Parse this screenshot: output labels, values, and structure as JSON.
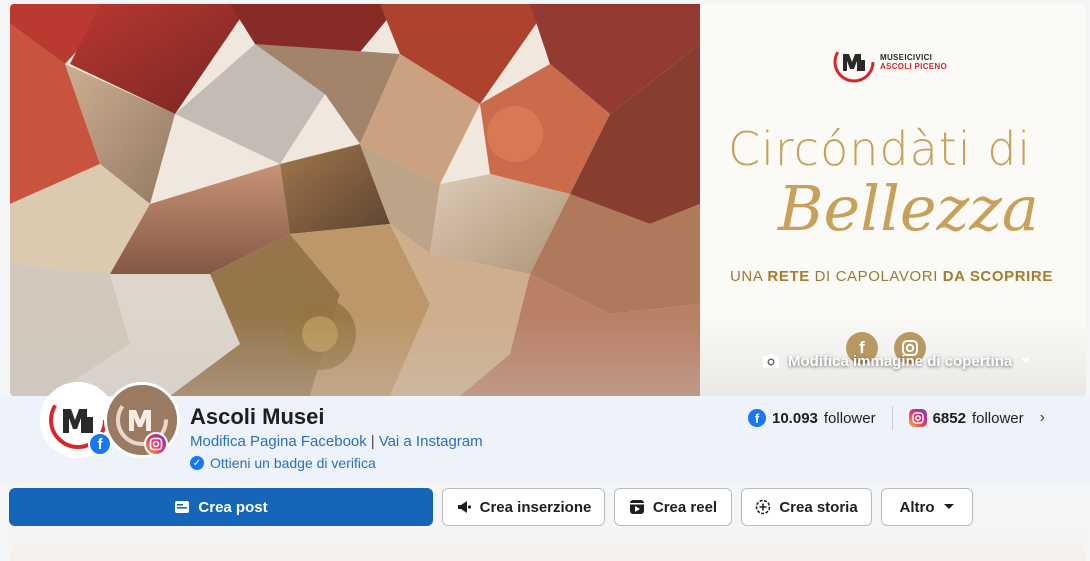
{
  "cover": {
    "brand_line1": "MUSEICIVICI",
    "brand_line2": "ASCOLI PICENO",
    "tagline_line1": "Circóndàti di",
    "tagline_line2": "Bellezza",
    "tagline_line3_prefix": "UNA ",
    "tagline_line3_bold1": "RETE",
    "tagline_line3_mid": " DI CAPOLAVORI ",
    "tagline_line3_bold2": "DA SCOPRIRE",
    "edit_label": "Modifica immagine di copertina",
    "social_fb_glyph": "f"
  },
  "profile": {
    "name": "Ascoli Musei",
    "link_edit": "Modifica Pagina Facebook",
    "link_separator": "|",
    "link_instagram": "Vai a Instagram",
    "verify_label": "Ottieni un badge di verifica",
    "fb_followers_count": "10.093",
    "fb_followers_label": "follower",
    "ig_followers_count": "6852",
    "ig_followers_label": "follower"
  },
  "actions": {
    "create_post": "Crea post",
    "create_ad": "Crea inserzione",
    "create_reel": "Crea reel",
    "create_story": "Crea storia",
    "more": "Altro"
  },
  "icons": {
    "fb_icon": "facebook-icon",
    "ig_icon": "instagram-icon",
    "camera": "camera-icon",
    "chevron": "chevron-right-icon"
  },
  "colors": {
    "primary_button": "#1565b8",
    "gold": "#c7a15a",
    "facebook_blue": "#1877f2",
    "link": "#2b6fb8"
  }
}
